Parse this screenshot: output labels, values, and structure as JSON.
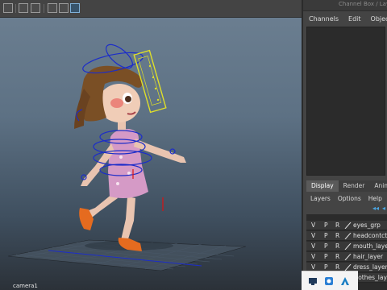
{
  "viewport": {
    "camera_label": "camera1",
    "toolbar_icons": [
      "grid-icon",
      "wireframe-icon",
      "smooth-shade-icon",
      "textured-icon",
      "lights-icon",
      "isolate-icon",
      "xray-icon",
      "resolution-gate-icon"
    ]
  },
  "panel": {
    "top_strip_text": "Channel Box / Layer Editor",
    "channel_box_menu": [
      "Channels",
      "Edit",
      "Object"
    ],
    "layer_tabs": [
      "Display",
      "Render",
      "Anim"
    ],
    "layer_menu": [
      "Layers",
      "Options",
      "Help"
    ],
    "layers": [
      {
        "v": "V",
        "p": "P",
        "r": "R",
        "name": "eyes_grp"
      },
      {
        "v": "V",
        "p": "P",
        "r": "R",
        "name": "headcontcts"
      },
      {
        "v": "V",
        "p": "P",
        "r": "R",
        "name": "mouth_layer"
      },
      {
        "v": "V",
        "p": "P",
        "r": "R",
        "name": "hair_layer"
      },
      {
        "v": "V",
        "p": "P",
        "r": "R",
        "name": "dress_layer"
      },
      {
        "v": "V",
        "p": "P",
        "r": "R",
        "name": "clothes_layer"
      }
    ]
  },
  "taskbar": {
    "icons": [
      "screen-capture-icon",
      "photo-app-icon",
      "autodesk-icon"
    ]
  }
}
